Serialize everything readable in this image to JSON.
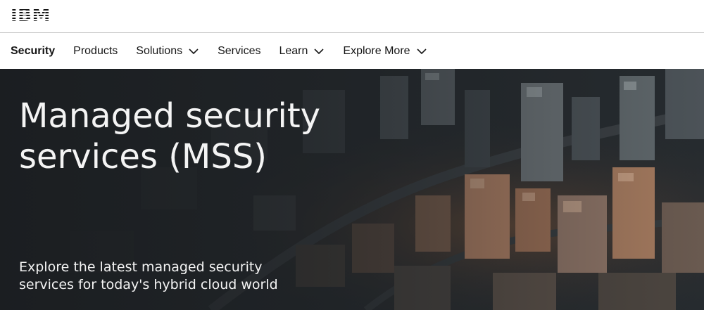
{
  "brand": {
    "logo_text": "IBM"
  },
  "nav": {
    "items": [
      {
        "label": "Security",
        "has_dropdown": false,
        "active": true
      },
      {
        "label": "Products",
        "has_dropdown": false
      },
      {
        "label": "Solutions",
        "has_dropdown": true
      },
      {
        "label": "Services",
        "has_dropdown": false
      },
      {
        "label": "Learn",
        "has_dropdown": true
      },
      {
        "label": "Explore More",
        "has_dropdown": true
      }
    ]
  },
  "hero": {
    "title": "Managed security services (MSS)",
    "subtitle": "Explore the latest managed security services for today's hybrid cloud world",
    "image": "aerial-city-skyline"
  },
  "colors": {
    "text": "#161616",
    "hero_text": "#f4f4f4",
    "divider": "#c6c6c6",
    "hero_bg": "#1f2428"
  }
}
